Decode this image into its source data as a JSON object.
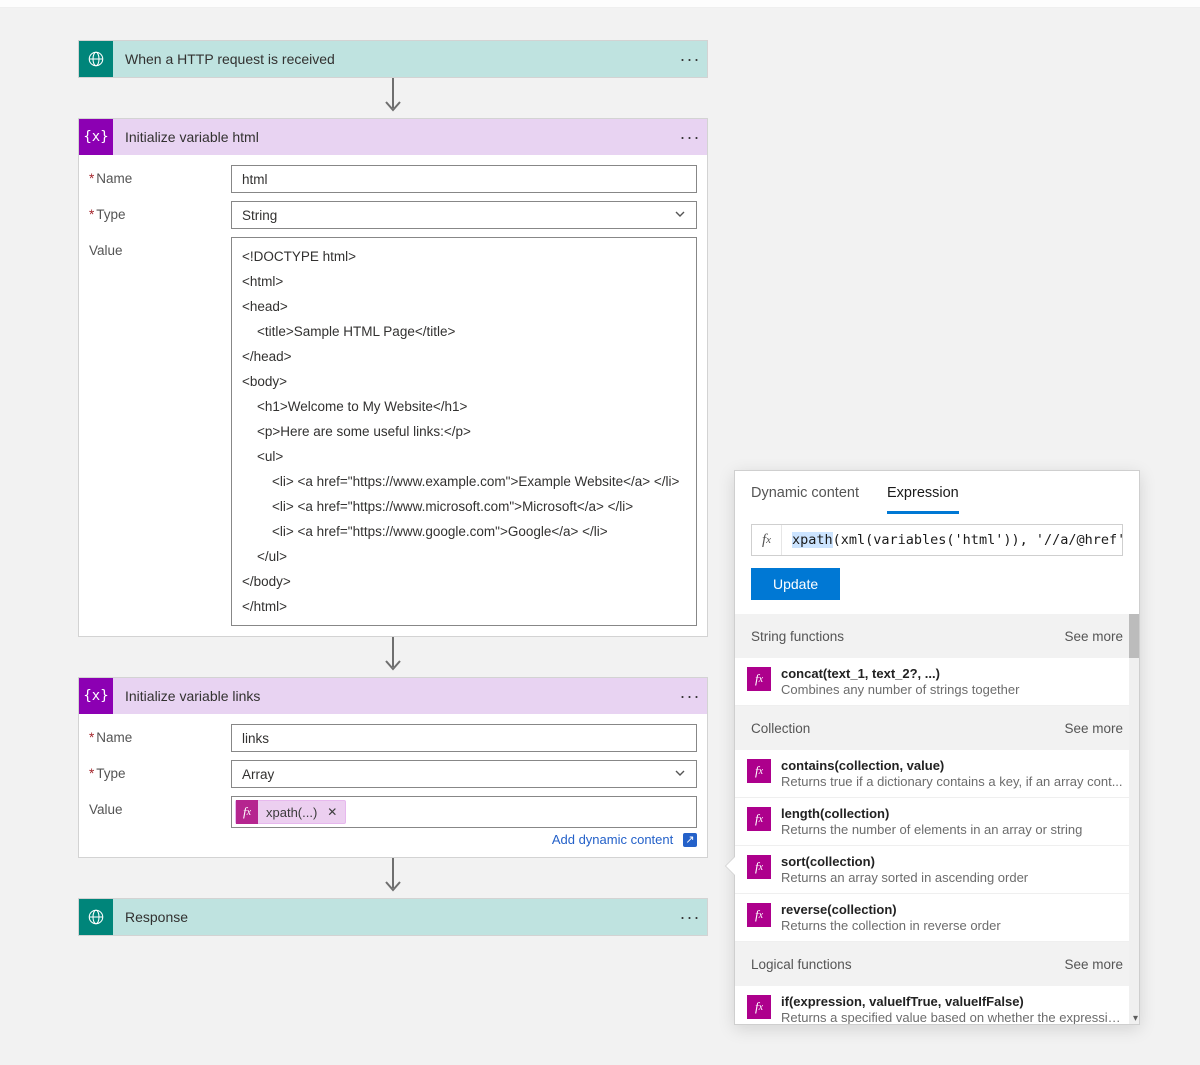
{
  "trigger": {
    "title": "When a HTTP request is received"
  },
  "step_var_html": {
    "title": "Initialize variable html",
    "name_label": "Name",
    "name_value": "html",
    "type_label": "Type",
    "type_value": "String",
    "value_label": "Value",
    "value_text": "<!DOCTYPE html>\n<html>\n<head>\n    <title>Sample HTML Page</title>\n</head>\n<body>\n    <h1>Welcome to My Website</h1>\n    <p>Here are some useful links:</p>\n    <ul>\n        <li> <a href=\"https://www.example.com\">Example Website</a> </li>\n        <li> <a href=\"https://www.microsoft.com\">Microsoft</a> </li>\n        <li> <a href=\"https://www.google.com\">Google</a> </li>\n    </ul>\n</body>\n</html>"
  },
  "step_var_links": {
    "title": "Initialize variable links",
    "name_label": "Name",
    "name_value": "links",
    "type_label": "Type",
    "type_value": "Array",
    "value_label": "Value",
    "token_label": "xpath(...)",
    "add_dynamic": "Add dynamic content"
  },
  "step_response": {
    "title": "Response"
  },
  "panel": {
    "tab_dynamic": "Dynamic content",
    "tab_expression": "Expression",
    "expression_prefix": "xpath",
    "expression_rest": "(xml(variables('html')), '//a/@href'",
    "update": "Update",
    "see_more": "See more",
    "sections": [
      {
        "title": "String functions",
        "items": [
          {
            "name": "concat(text_1, text_2?, ...)",
            "desc": "Combines any number of strings together"
          }
        ]
      },
      {
        "title": "Collection",
        "items": [
          {
            "name": "contains(collection, value)",
            "desc": "Returns true if a dictionary contains a key, if an array cont..."
          },
          {
            "name": "length(collection)",
            "desc": "Returns the number of elements in an array or string"
          },
          {
            "name": "sort(collection)",
            "desc": "Returns an array sorted in ascending order"
          },
          {
            "name": "reverse(collection)",
            "desc": "Returns the collection in reverse order"
          }
        ]
      },
      {
        "title": "Logical functions",
        "items": [
          {
            "name": "if(expression, valueIfTrue, valueIfFalse)",
            "desc": "Returns a specified value based on whether the expression..."
          }
        ]
      }
    ]
  }
}
